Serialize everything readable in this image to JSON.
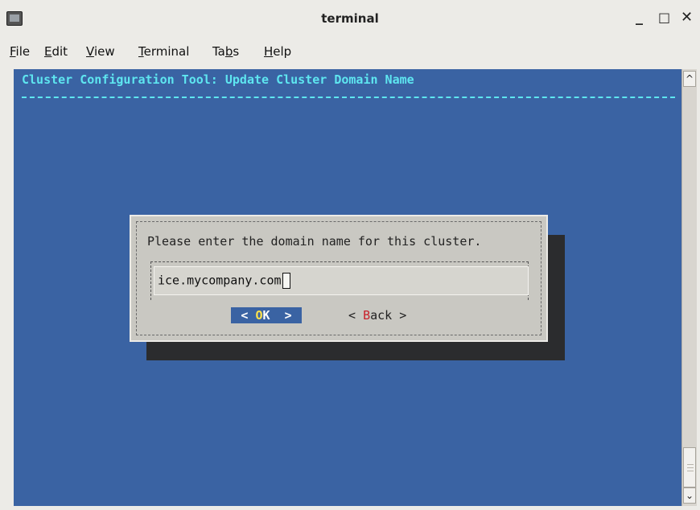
{
  "window": {
    "title": "terminal",
    "minimize": "_",
    "maximize": "□",
    "close": "✕"
  },
  "menu": [
    {
      "hot": "F",
      "rest": "ile"
    },
    {
      "hot": "E",
      "rest": "dit"
    },
    {
      "hot": "V",
      "rest": "iew"
    },
    {
      "hot": "T",
      "rest": "erminal"
    },
    {
      "pre": "Ta",
      "hot": "b",
      "rest": "s"
    },
    {
      "hot": "H",
      "rest": "elp"
    }
  ],
  "terminal": {
    "header": "Cluster Configuration Tool: Update Cluster Domain Name",
    "dialog": {
      "prompt": "Please enter the domain name for this cluster.",
      "input_value": "ice.mycompany.com",
      "ok": {
        "left": "< ",
        "hot": "O",
        "rest": "K",
        "right": "  >"
      },
      "back": {
        "left": "< ",
        "hot": "B",
        "rest": "ack",
        "right": " >"
      }
    }
  },
  "icons": {
    "app": "terminal-app-icon",
    "scroll_up": "chevron-up-icon",
    "scroll_down": "chevron-down-icon"
  }
}
